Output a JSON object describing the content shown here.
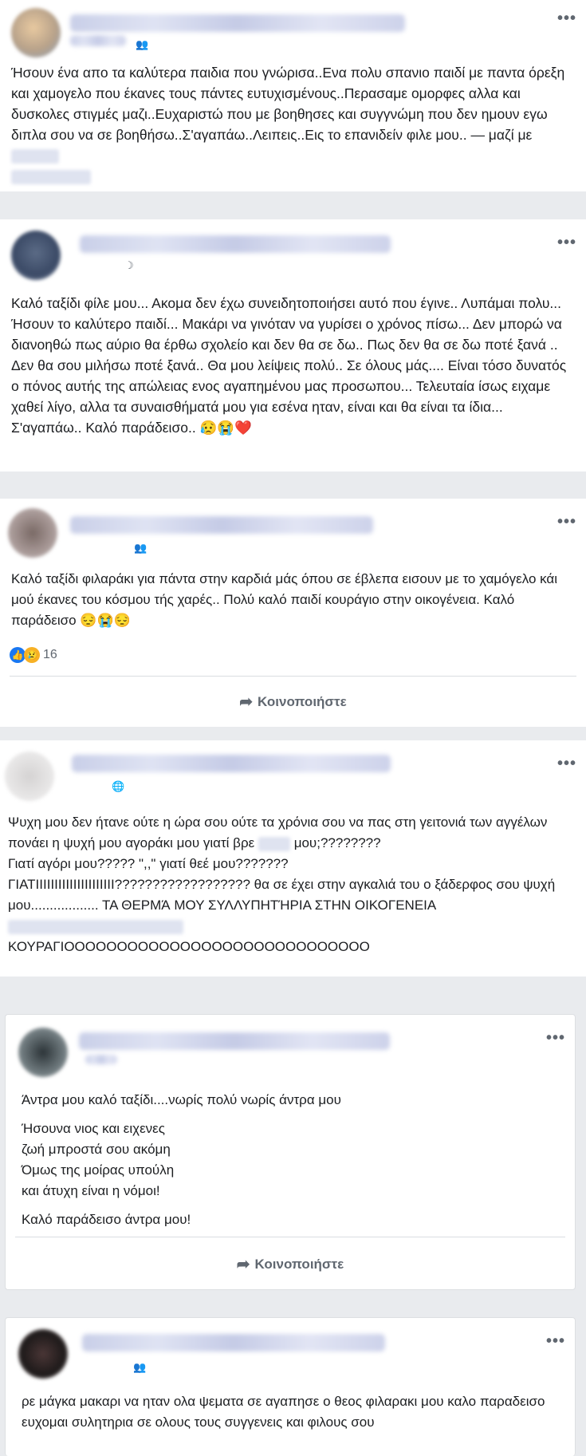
{
  "posts": [
    {
      "dots": "•••",
      "text": "Ήσουν ένα απο τα καλύτερα παιδια που γνώρισα..Ενα πολυ σπανιο παιδί με παντα όρεξη και χαμογελο που έκανες τους πάντες ευτυχισμένους..Περασαμε ομορφες αλλα και δυσκολες στιγμές μαζι..Ευχαριστώ που με βοηθησες και συγγνώμη που δεν ημουν εγω διπλα σου να σε βοηθήσω..Σ'αγαπάω..Λειπεις..Εις το επανιδείν φιλε μου.. — μαζί με"
    },
    {
      "dots": "•••",
      "text": "Καλό ταξίδι φίλε μου... Ακομα δεν έχω συνειδητοποιήσει αυτό που έγινε.. Λυπάμαι πολυ... Ήσουν το καλύτερο παιδί... Μακάρι να γινόταν να γυρίσει ο χρόνος πίσω... Δεν μπορώ να διανοηθώ πως αύριο θα έρθω σχολείο και δεν θα σε δω.. Πως δεν θα σε δω ποτέ ξανά .. Δεν θα σου μιλήσω ποτέ ξανά.. Θα μου λείψεις πολύ.. Σε όλους μάς.... Είναι τόσο δυνατός ο πόνος αυτής της απώλειας ενος αγαπημένου μας προσωπου... Τελευταία ίσως ειχαμε χαθεί λίγο, αλλα τα συναισθήματά μου για εσένα ηταν, είναι και θα είναι τα ίδια... Σ'αγαπάω.. Καλό παράδεισο..",
      "emoji": "😥😭❤️"
    },
    {
      "dots": "•••",
      "text": "Καλό ταξίδι φιλαράκι για πάντα στην καρδιά μάς όπου σε έβλεπα εισουν με το χαμόγελο κάι μού έκανες του κόσμου τής χαρές.. Πολύ καλό παιδί κουράγιο στην οικογένεια. Καλό παράδεισο",
      "emoji": "😔😭😔",
      "reactions": "16",
      "share": "Κοινοποιήστε"
    },
    {
      "dots": "•••",
      "line1": "Ψυχη μου δεν ήτανε ούτε η ώρα σου ούτε τα χρόνια σου να πας στη γειτονιά των αγγέλων πονάει η ψυχή μου αγοράκι μου γιατί βρε",
      "line1b": "μου;????????",
      "line2": "Γιατί αγόρι μου????? \",,\" γιατί θεέ μου???????",
      "line3": "ΓΙΑΤΙΙΙΙΙΙΙΙΙΙΙΙΙΙΙΙΙΙΙΙΙ?????????????????? θα σε έχει στην αγκαλιά του ο ξάδερφος σου ψυχή μου.................. ΤΑ ΘΕΡΜΆ ΜΟΥ ΣΥΛΛΥΠΗΤΉΡΙΑ ΣΤΗΝ ΟΙΚΟΓΕΝΕΙΑ",
      "line4": "ΚΟΥΡΑΓΙΟΟΟΟΟΟΟΟΟΟΟΟΟΟΟΟΟΟΟΟΟΟΟΟΟΟΟΟΟ"
    },
    {
      "dots": "•••",
      "p1": "Άντρα μου καλό ταξίδι....νωρίς πολύ νωρίς άντρα μου",
      "p2a": "Ήσουνα νιος και ειχενες",
      "p2b": "ζωή μπροστά σου ακόμη",
      "p2c": "Όμως της μοίρας υπούλη",
      "p2d": "και άτυχη είναι η νόμοι!",
      "p3": "Καλό παράδεισο άντρα μου!",
      "share": "Κοινοποιήστε"
    },
    {
      "dots": "•••",
      "text": "ρε μάγκα μακαρι να ηταν ολα ψεματα σε αγαπησε ο θεος φιλαρακι μου καλο παραδεισο ευχομαι συλητηρια σε ολους τους συγγενεις και φιλους σου"
    }
  ],
  "colors": {
    "like": "#1877f2",
    "sad": "#f7b125",
    "bg": "#e9ebee"
  }
}
